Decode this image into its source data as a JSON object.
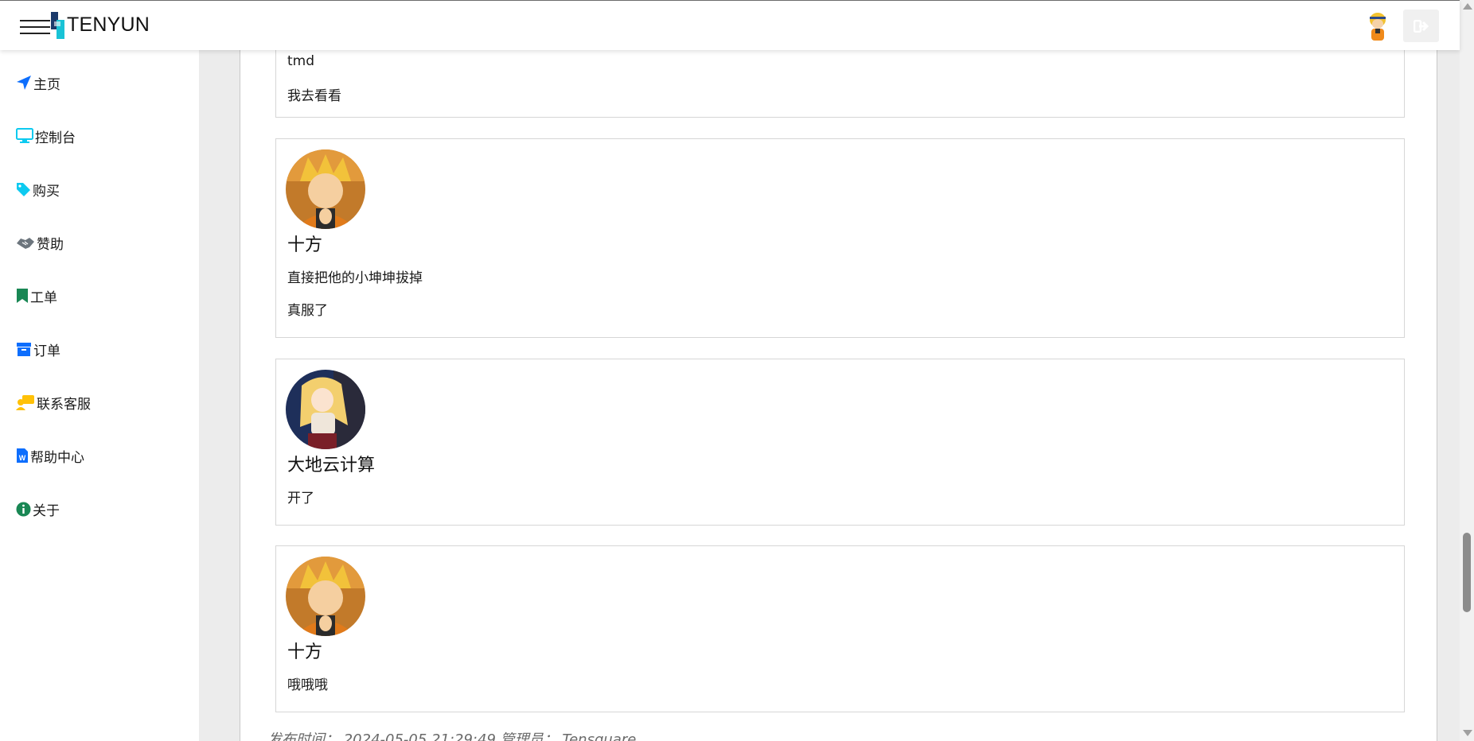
{
  "header": {
    "brand": "TENYUN"
  },
  "sidebar": {
    "items": [
      {
        "label": "主页",
        "icon": "location-arrow-icon",
        "color": "#0d6efd"
      },
      {
        "label": "控制台",
        "icon": "monitor-icon",
        "color": "#0dcaf0"
      },
      {
        "label": "购买",
        "icon": "tag-icon",
        "color": "#0dcaf0"
      },
      {
        "label": "赞助",
        "icon": "handshake-icon",
        "color": "#6c757d"
      },
      {
        "label": "工单",
        "icon": "bookmark-icon",
        "color": "#198754"
      },
      {
        "label": "订单",
        "icon": "archive-icon",
        "color": "#0d6efd"
      },
      {
        "label": "联系客服",
        "icon": "person-chat-icon",
        "color": "#ffc107"
      },
      {
        "label": "帮助中心",
        "icon": "word-document-icon",
        "color": "#0d6efd"
      },
      {
        "label": "关于",
        "icon": "info-circle-icon",
        "color": "#198754"
      }
    ]
  },
  "comments": [
    {
      "lines": [
        "tmd",
        "我去看看"
      ]
    },
    {
      "name": "十方",
      "avatar": "naruto-avatar",
      "lines": [
        "直接把他的小坤坤拔掉",
        "真服了"
      ]
    },
    {
      "name": "大地云计算",
      "avatar": "anime-girl-avatar",
      "lines": [
        "开了"
      ]
    },
    {
      "name": "十方",
      "avatar": "naruto-avatar",
      "lines": [
        "哦哦哦"
      ]
    }
  ],
  "footer": {
    "meta": "发布时间： 2024-05-05 21:29:49 管理员： Tensquare"
  }
}
